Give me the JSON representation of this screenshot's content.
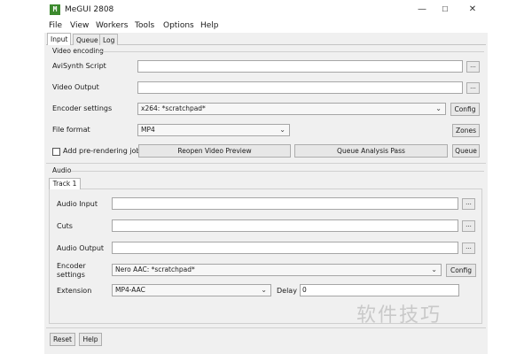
{
  "window": {
    "icon_glyph": "M",
    "title": "MeGUI 2808",
    "controls": {
      "minimize": "—",
      "maximize": "☐",
      "close": "✕"
    }
  },
  "menu": [
    "File",
    "View",
    "Workers",
    "Tools",
    "Options",
    "Help"
  ],
  "tabs": [
    "Input",
    "Queue",
    "Log"
  ],
  "video": {
    "group_label": "Video encoding",
    "avisynth_label": "AviSynth Script",
    "avisynth_value": "",
    "output_label": "Video Output",
    "output_value": "",
    "encoder_label": "Encoder settings",
    "encoder_value": "x264: *scratchpad*",
    "config_label": "Config",
    "format_label": "File format",
    "format_value": "MP4",
    "zones_label": "Zones",
    "prerender_label": "Add pre-rendering job",
    "reopen_label": "Reopen Video Preview",
    "queue_analysis_label": "Queue Analysis Pass",
    "queue_label": "Queue",
    "browse_label": "..."
  },
  "audio": {
    "group_label": "Audio",
    "track_tab": "Track 1",
    "input_label": "Audio Input",
    "input_value": "",
    "cuts_label": "Cuts",
    "cuts_value": "",
    "output_label": "Audio Output",
    "output_value": "",
    "encoder_label_line1": "Encoder",
    "encoder_label_line2": "settings",
    "encoder_value": "Nero AAC: *scratchpad*",
    "config_label": "Config",
    "extension_label": "Extension",
    "extension_value": "MP4-AAC",
    "delay_label": "Delay",
    "delay_value": "0",
    "browse_label": "..."
  },
  "footer": {
    "reset_label": "Reset",
    "help_label": "Help"
  },
  "watermark": "软件技巧"
}
